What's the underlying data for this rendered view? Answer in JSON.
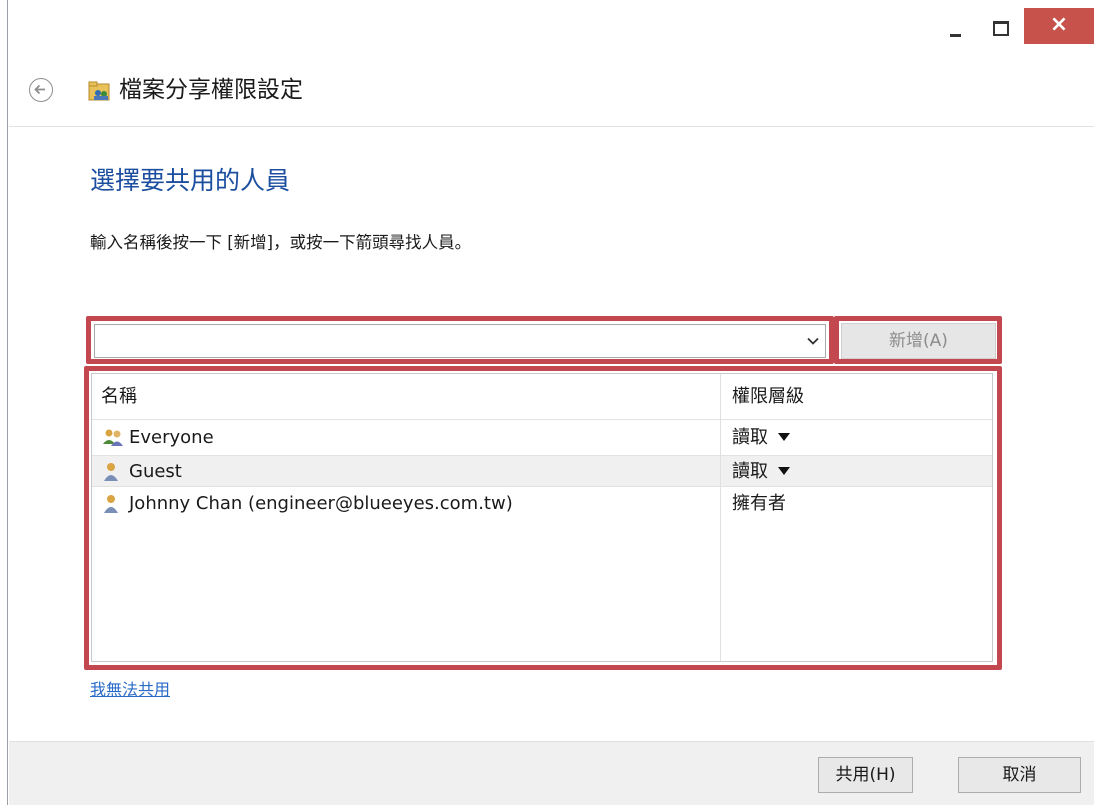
{
  "window": {
    "close_glyph": "×",
    "title": "檔案分享權限設定"
  },
  "page": {
    "heading": "選擇要共用的人員",
    "instruction": "輸入名稱後按一下 [新增]，或按一下箭頭尋找人員。"
  },
  "input": {
    "value": "",
    "add_button_label": "新增(A)"
  },
  "list": {
    "columns": [
      "名稱",
      "權限層級"
    ],
    "rows": [
      {
        "icon": "group-icon",
        "name": "Everyone",
        "permission": "讀取",
        "has_dropdown": true
      },
      {
        "icon": "user-icon",
        "name": "Guest",
        "permission": "讀取",
        "has_dropdown": true
      },
      {
        "icon": "user-icon",
        "name": "Johnny Chan (engineer@blueeyes.com.tw)",
        "permission": "擁有者",
        "has_dropdown": false
      }
    ]
  },
  "links": {
    "help": "我無法共用"
  },
  "footer": {
    "share_label": "共用(H)",
    "cancel_label": "取消"
  },
  "colors": {
    "heading": "#1c4ea0",
    "highlight": "#c2474f",
    "close_button": "#c7514b",
    "link": "#2a6bc8"
  }
}
